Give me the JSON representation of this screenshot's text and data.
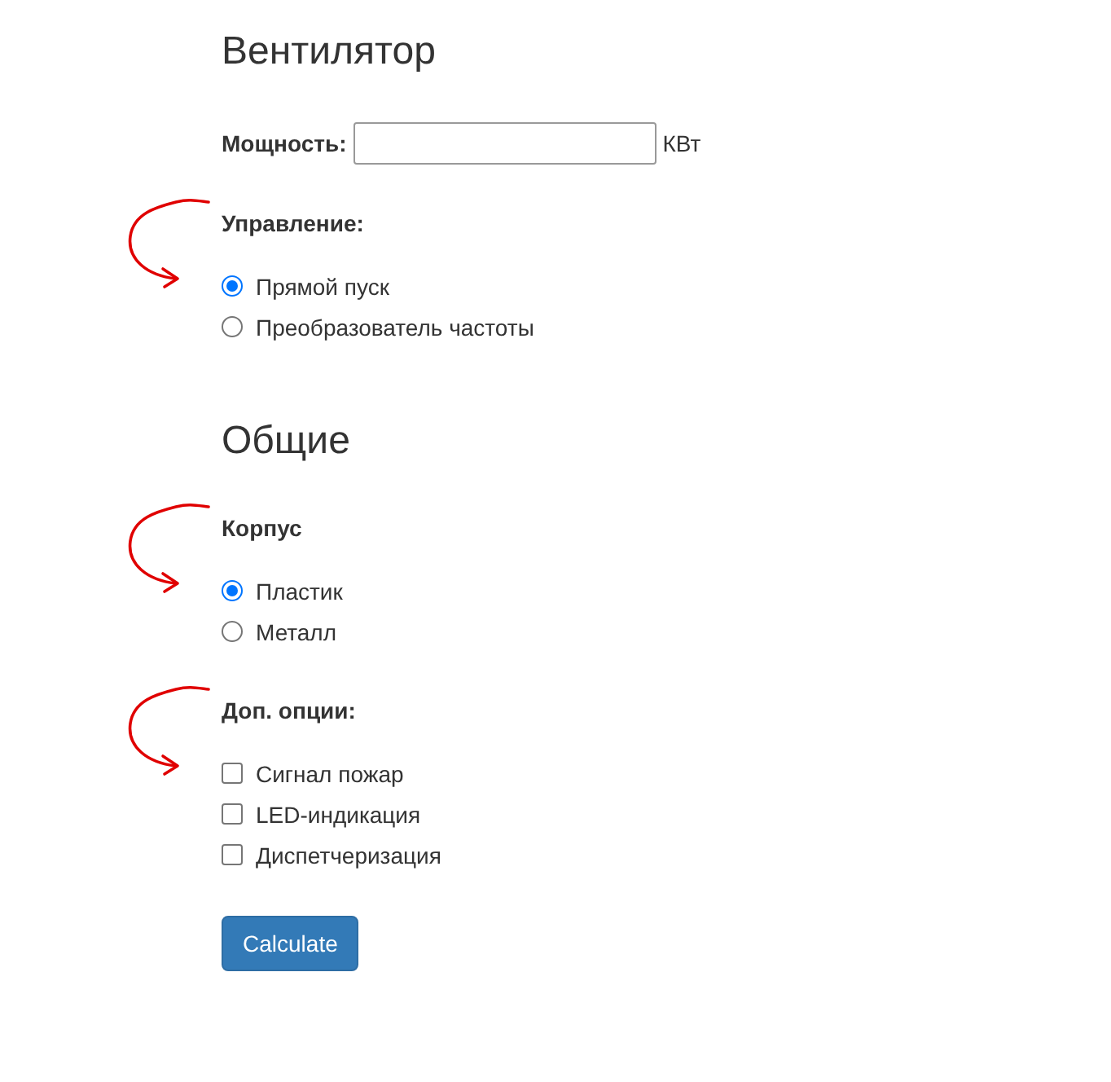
{
  "sections": [
    {
      "title": "Вентилятор",
      "fields": [
        {
          "kind": "number",
          "label": "Мощность:",
          "unit": "КВт"
        },
        {
          "kind": "radio",
          "label": "Управление:",
          "annotated": true,
          "options": [
            {
              "label": "Прямой пуск",
              "selected": true
            },
            {
              "label": "Преобразователь частоты",
              "selected": false
            }
          ]
        }
      ]
    },
    {
      "title": "Общие",
      "fields": [
        {
          "kind": "radio",
          "label": "Корпус",
          "annotated": true,
          "options": [
            {
              "label": "Пластик",
              "selected": true
            },
            {
              "label": "Металл",
              "selected": false
            }
          ]
        },
        {
          "kind": "checkbox",
          "label": "Доп. опции:",
          "annotated": true,
          "options": [
            {
              "label": "Сигнал пожар",
              "checked": false
            },
            {
              "label": "LED-индикация",
              "checked": false
            },
            {
              "label": "Диспетчеризация",
              "checked": false
            }
          ]
        }
      ]
    }
  ],
  "button": "Calculate"
}
